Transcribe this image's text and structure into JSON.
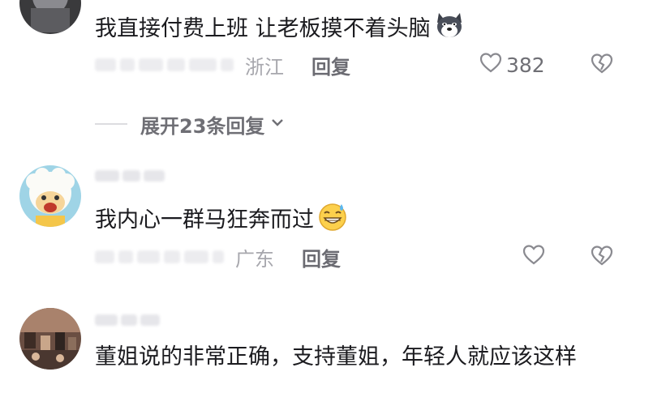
{
  "comments": [
    {
      "text": "我直接付费上班 让老板摸不着头脑",
      "emoji": "dog-face-icon",
      "region": "浙江",
      "reply_label": "回复",
      "likes": "382"
    },
    {
      "expand_label": "展开23条回复"
    },
    {
      "text": "我内心一群马狂奔而过",
      "emoji": "grinning-sweat-icon",
      "region": "广东",
      "reply_label": "回复",
      "likes": ""
    },
    {
      "text": "董姐说的非常正确，支持董姐，年轻人就应该这样"
    }
  ],
  "colors": {
    "text": "#1b1b1f",
    "meta": "#a3a3a8",
    "action": "#6b6b72"
  }
}
